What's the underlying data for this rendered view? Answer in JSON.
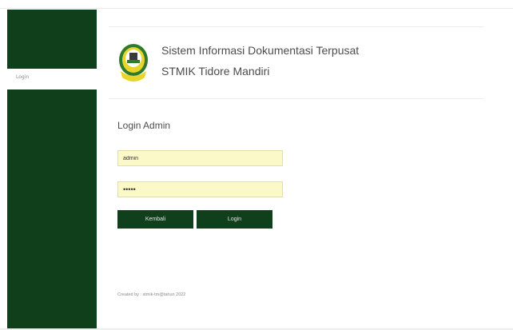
{
  "sidebar": {
    "login_link": "Login"
  },
  "header": {
    "title_line1": "Sistem Informasi Dokumentasi Terpusat",
    "title_line2": "STMIK Tidore Mandiri",
    "logo_icon": "stmik-logo-icon"
  },
  "login": {
    "heading": "Login Admin",
    "username_value": "admin",
    "password_value": "•••••",
    "back_label": "Kembali",
    "login_label": "Login"
  },
  "footer": {
    "text": "Created by : stmik-tm@tahun 2022"
  },
  "colors": {
    "sidebar": "#0f3f1b",
    "button": "#0f3f1b",
    "input_bg": "#fcf9c8"
  }
}
